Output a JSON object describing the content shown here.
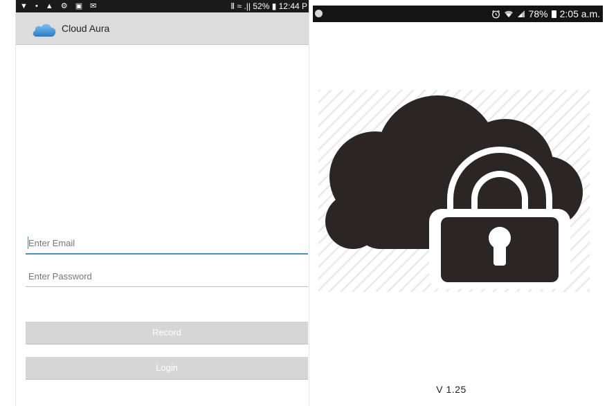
{
  "left_screen": {
    "status_bar": {
      "left_icons": "▼ • ▲ ⚙ ▣ ✉",
      "right_text": "Ⅱ ≈ .|| 52% ▮ 12:44 P"
    },
    "app_bar": {
      "title": "Cloud Aura",
      "icon": "cloud-icon",
      "icon_color": "#3b8fd6"
    },
    "email_field": {
      "placeholder": "Enter Email",
      "value": ""
    },
    "password_field": {
      "placeholder": "Enter Password",
      "value": ""
    },
    "record_button": {
      "label": "Record"
    },
    "login_button": {
      "label": "Login"
    }
  },
  "right_screen": {
    "status_bar": {
      "alarm_icon": "alarm-icon",
      "wifi_icon": "wifi-icon",
      "signal_icon": "signal-icon",
      "battery_text": "78%",
      "battery_icon": "battery-icon",
      "time": "2:05 a.m."
    },
    "splash": {
      "image": "cloud-lock-icon",
      "color": "#2b2526"
    },
    "version": "V 1.25"
  },
  "colors": {
    "accent": "#4a90b8",
    "button_bg": "#d6d6d6",
    "app_bar_bg": "#dcdcdc"
  }
}
